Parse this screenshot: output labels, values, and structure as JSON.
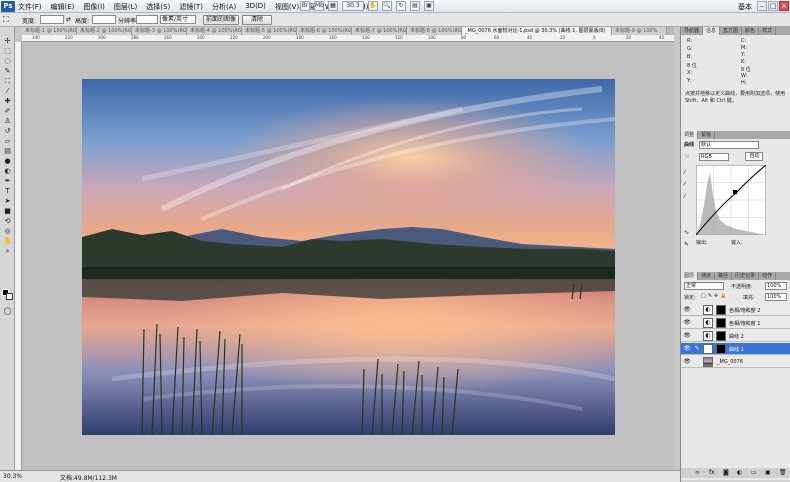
{
  "app": {
    "logo": "Ps",
    "workspace": "基本",
    "zoom_dropdown": "30.3"
  },
  "menu": [
    "文件(F)",
    "编辑(E)",
    "图像(I)",
    "图层(L)",
    "选择(S)",
    "滤镜(T)",
    "分析(A)",
    "3D(D)",
    "视图(V)",
    "窗口(W)",
    "帮助(H)"
  ],
  "options": {
    "width_label": "宽度:",
    "height_label": "高度:",
    "resolution_label": "分辨率:",
    "unit": "像素/英寸",
    "front_image_button": "前面的图像",
    "clear_button": "清除"
  },
  "tabs": [
    {
      "label": "未标题-1 @ 100%(RGB/8)",
      "active": false
    },
    {
      "label": "未标题-2 @ 100%(RGB/8)",
      "active": false
    },
    {
      "label": "未标题-3 @ 100%(RGB/8)",
      "active": false
    },
    {
      "label": "未标题-4 @ 100%(RGB/8)",
      "active": false
    },
    {
      "label": "未标题-5 @ 100%(RGB/8)",
      "active": false
    },
    {
      "label": "未标题-6 @ 100%(RGB/8)",
      "active": false
    },
    {
      "label": "未标题-7 @ 100%(RGB/8)",
      "active": false
    },
    {
      "label": "未标题-8 @ 100%(RGB/8)",
      "active": false
    },
    {
      "label": "_MG_0076 水面较对比-1.psd @ 30.3% (曲线 1, 图层蒙版/8)",
      "active": true
    },
    {
      "label": "未标题-9 @ 100%",
      "active": false
    }
  ],
  "ruler_labels": [
    "340",
    "320",
    "300",
    "280",
    "260",
    "240",
    "220",
    "200",
    "180",
    "160",
    "140",
    "120",
    "100",
    "80",
    "60",
    "40",
    "20",
    "0",
    "20",
    "40"
  ],
  "status": {
    "zoom": "30.3%",
    "doc": "文档:49.8M/112.3M"
  },
  "info_panel": {
    "tabs": [
      {
        "label": "导航器",
        "active": false
      },
      {
        "label": "信息",
        "active": true
      },
      {
        "label": "直方图",
        "active": false
      },
      {
        "label": "颜色",
        "active": false
      },
      {
        "label": "样式",
        "active": false
      }
    ],
    "rows": [
      "R:",
      "G:",
      "B:",
      "8 位",
      "X:",
      "Y:"
    ],
    "rows2": [
      "C:",
      "M:",
      "Y:",
      "K:",
      "8 位",
      "W:",
      "H:"
    ],
    "hint": "点按并拖移以定义曲线，要用附加选项，使用 Shift、Alt 和 Ctrl 键。"
  },
  "adjust_panel": {
    "tabs": [
      {
        "label": "调整",
        "active": true
      },
      {
        "label": "蒙版",
        "active": false
      }
    ],
    "title": "曲线",
    "preset": "默认",
    "channel": "RGB",
    "auto_button": "自动",
    "output_label": "输出:",
    "input_label": "输入:"
  },
  "layers_panel": {
    "tabs": [
      {
        "label": "图层",
        "active": true
      },
      {
        "label": "通道",
        "active": false
      },
      {
        "label": "路径",
        "active": false
      },
      {
        "label": "历史记录",
        "active": false
      },
      {
        "label": "动作",
        "active": false
      }
    ],
    "blend_mode": "正常",
    "opacity_label": "不透明度:",
    "opacity_value": "100%",
    "lock_label": "锁定:",
    "fill_label": "填充:",
    "fill_value": "100%",
    "layers": [
      {
        "name": "色相/饱和度 2",
        "selected": false
      },
      {
        "name": "色相/饱和度 1",
        "selected": false
      },
      {
        "name": "曲线 2",
        "selected": false
      },
      {
        "name": "曲线 1",
        "selected": true
      },
      {
        "name": "_MG_0076",
        "selected": false
      }
    ]
  },
  "colors": {
    "selection": "#3875d7",
    "panel_bg": "#e8e8e8",
    "canvas_bg": "#c0c0c0"
  }
}
